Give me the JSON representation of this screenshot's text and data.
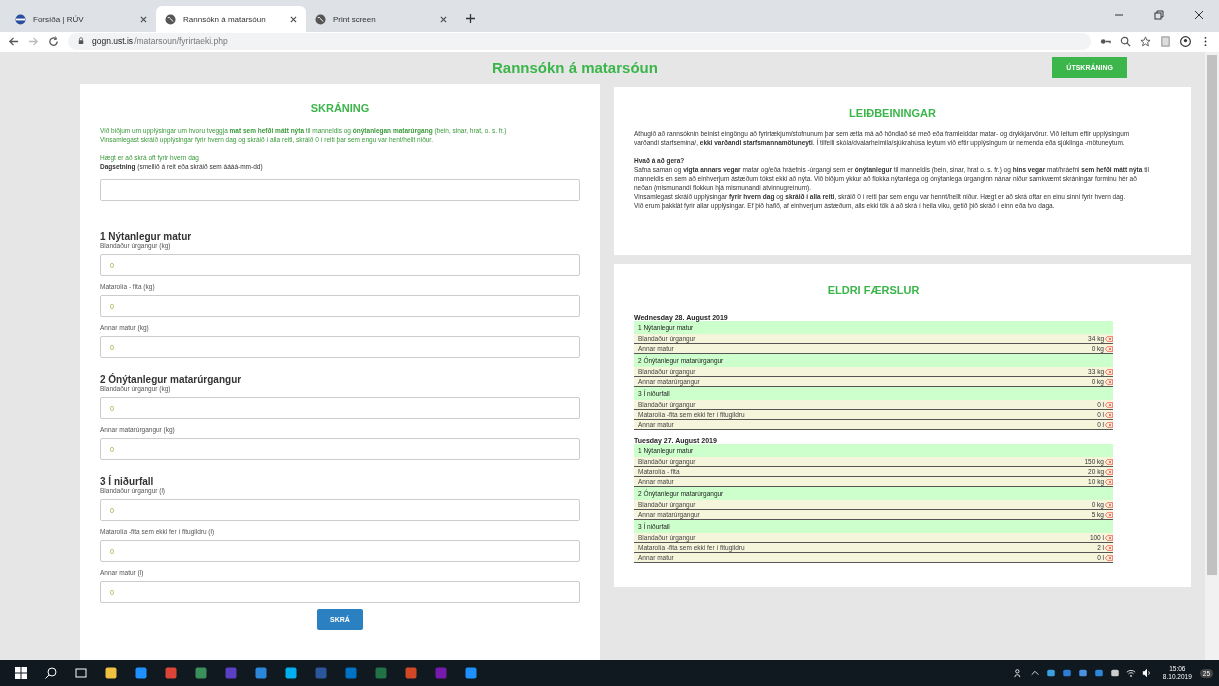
{
  "browser": {
    "tabs": [
      {
        "title": "Forsíða | RÚV",
        "selected": false
      },
      {
        "title": "Rannsókn á matarsóun",
        "selected": true
      },
      {
        "title": "Print screen",
        "selected": false
      }
    ],
    "address": {
      "host": "gogn.ust.is",
      "path": "/matarsoun/fyrirtaeki.php"
    }
  },
  "page": {
    "title": "Rannsókn á matarsóun",
    "logout": "ÚTSKRÁNING"
  },
  "form": {
    "heading": "SKRÁNING",
    "intro": [
      "Við biðjum um upplýsingar um hvoru tveggja **mat sem hefði mátt nýta** til manneldis og **ónýtanlegan matarúrgang** (bein, sinar, hrat, o. s. fr.)",
      "Vinsamlegast skráið upplýsingar fyrir hvern dag og skráið í alla reiti, skráið 0 í reiti þar sem engu var hent/hellt niður."
    ],
    "note": "Hægt er að skrá oft fyrir hvern dag",
    "date_label": "**Dagsetning** (smellið á reit eða skráið sem áááá-mm-dd)",
    "sections": [
      {
        "title": "1 Nýtanlegur matur",
        "fields": [
          {
            "label": "Blandaður úrgangur (kg)",
            "value": "0"
          },
          {
            "label": "Matarolía - fita (kg)",
            "value": "0"
          },
          {
            "label": "Annar matur (kg)",
            "value": "0"
          }
        ]
      },
      {
        "title": "2 Ónýtanlegur matarúrgangur",
        "fields": [
          {
            "label": "Blandaður úrgangur (kg)",
            "value": "0"
          },
          {
            "label": "Annar matarúrgangur (kg)",
            "value": "0"
          }
        ]
      },
      {
        "title": "3 Í niðurfall",
        "fields": [
          {
            "label": "Blandaður úrgangur (l)",
            "value": "0"
          },
          {
            "label": "Matarolía -fita sem ekki fer í fitugildru (l)",
            "value": "0"
          },
          {
            "label": "Annar matur (l)",
            "value": "0"
          }
        ]
      }
    ],
    "submit": "SKRÁ"
  },
  "instructions": {
    "heading": "LEIÐBEININGAR",
    "paragraphs": [
      "Athugið að rannsóknin beinist eingöngu að fyrirtækjum/stofnunum þar sem ætla má að höndlað sé með eða framleiddar matar- og drykkjarvörur. Við leitum eftir upplýsingum varðandi starfsemina/, **ekki varðandi starfsmannamötuneyti**. Í tilfelli skóla/dvalarheimila/sjúkrahúsa leytum við eftir upplýsingum úr nemenda eða sjúklinga -mötuneytum."
    ],
    "subheading": "Hvað á að gera?",
    "steps": [
      "Safna saman og **vigta annars vegar** matar og/eða hráefnis -úrgangi sem er **ónýtanlegur** til manneldis (bein, sinar, hrat o. s. fr.) og **hins vegar** mat/hráefni **sem hefði mátt nýta** til manneldis en sem að einhverjum ástæðum tókst ekki að nýta. Við biðjum ykkur að flokka nýtanlega og ónýtanlega úrganginn nánar niður samkvæmt skráningar forminu hér að neðan (mismunandi flokkun hjá mismunandi atvinnugreinum).",
      "Vinsamlegast skráið upplýsingar **fyrir hvern dag** og **skráið í alla reiti**, skráið 0 í reiti þar sem engu var hennt/hellt niður. Hægt er að skrá oftar en einu sinni fyrir hvern dag.",
      "Við erum þakklát fyrir allar upplýsingar. Ef þið hafið, af einhverjum ástæðum, alls ekki tök á að skrá í heila viku, getið þið skráð í einn eða tvo daga."
    ]
  },
  "history": {
    "heading": "ELDRI FÆRSLUR",
    "days": [
      {
        "date": "Wednesday 28. August 2019",
        "groups": [
          {
            "title": "1 Nýtanlegur matur",
            "rows": [
              {
                "label": "Blandaður úrgangur",
                "value": "34 kg"
              },
              {
                "label": "Annar matur",
                "value": "0 kg"
              }
            ]
          },
          {
            "title": "2 Ónýtanlegur matarúrgangur",
            "rows": [
              {
                "label": "Blandaður úrgangur",
                "value": "33 kg"
              },
              {
                "label": "Annar matarúrgangur",
                "value": "0 kg"
              }
            ]
          },
          {
            "title": "3 Í niðurfall",
            "rows": [
              {
                "label": "Blandaður úrgangur",
                "value": "0 l"
              },
              {
                "label": "Matarolía -fita sem ekki fer í fitugildru",
                "value": "0 l"
              },
              {
                "label": "Annar matur",
                "value": "0 l"
              }
            ]
          }
        ]
      },
      {
        "date": "Tuesday 27. August 2019",
        "groups": [
          {
            "title": "1 Nýtanlegur matur",
            "rows": [
              {
                "label": "Blandaður úrgangur",
                "value": "150 kg"
              },
              {
                "label": "Matarolía - fita",
                "value": "20 kg"
              },
              {
                "label": "Annar matur",
                "value": "10 kg"
              }
            ]
          },
          {
            "title": "2 Ónýtanlegur matarúrgangur",
            "rows": [
              {
                "label": "Blandaður úrgangur",
                "value": "0 kg"
              },
              {
                "label": "Annar matarúrgangur",
                "value": "5 kg"
              }
            ]
          },
          {
            "title": "3 Í niðurfall",
            "rows": [
              {
                "label": "Blandaður úrgangur",
                "value": "100 l"
              },
              {
                "label": "Matarolía -fita sem ekki fer í fitugildru",
                "value": "2 l"
              },
              {
                "label": "Annar matur",
                "value": "0 l"
              }
            ]
          }
        ]
      }
    ]
  },
  "taskbar": {
    "time": "15:06",
    "date": "8.10.2019",
    "notifications": "25"
  }
}
